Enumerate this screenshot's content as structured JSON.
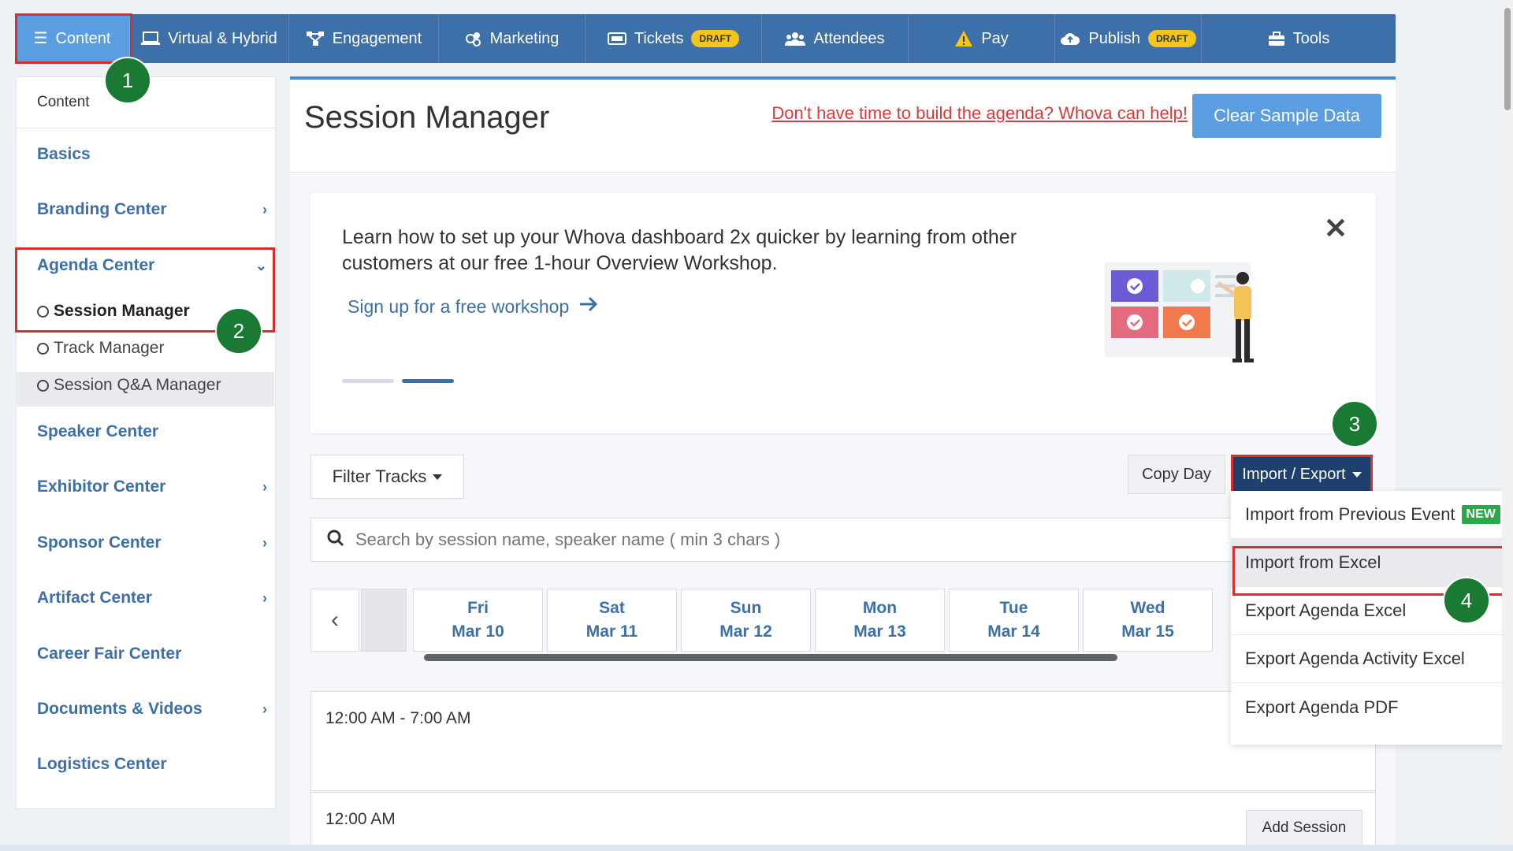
{
  "nav": {
    "tabs": [
      {
        "label": "Content",
        "icon": "list-icon"
      },
      {
        "label": "Virtual & Hybrid",
        "icon": "laptop-icon"
      },
      {
        "label": "Engagement",
        "icon": "network-icon"
      },
      {
        "label": "Marketing",
        "icon": "megaphone-icon"
      },
      {
        "label": "Tickets",
        "icon": "ticket-icon",
        "badge": "DRAFT"
      },
      {
        "label": "Attendees",
        "icon": "users-icon"
      },
      {
        "label": "Pay",
        "icon": "warning-icon"
      },
      {
        "label": "Publish",
        "icon": "cloud-upload-icon",
        "badge": "DRAFT"
      },
      {
        "label": "Tools",
        "icon": "toolbox-icon"
      }
    ],
    "active_tab": "Content",
    "colors": {
      "nav_bg": "#3d6fa8",
      "active": "#5a9de0",
      "draft_badge": "#f5c518"
    }
  },
  "steps": [
    "1",
    "2",
    "3",
    "4"
  ],
  "sidebar": {
    "header": "Content",
    "items": [
      {
        "label": "Basics",
        "chevron": ""
      },
      {
        "label": "Branding Center",
        "chevron": "›"
      },
      {
        "label": "Agenda Center",
        "chevron": "⌄"
      },
      {
        "label": "Speaker Center",
        "chevron": ""
      },
      {
        "label": "Exhibitor Center",
        "chevron": "›"
      },
      {
        "label": "Sponsor Center",
        "chevron": "›"
      },
      {
        "label": "Artifact Center",
        "chevron": "›"
      },
      {
        "label": "Career Fair Center",
        "chevron": ""
      },
      {
        "label": "Documents & Videos",
        "chevron": "›"
      },
      {
        "label": "Logistics Center",
        "chevron": ""
      }
    ],
    "agenda_subitems": [
      "Session Manager",
      "Track Manager",
      "Session Q&A Manager"
    ],
    "active_subitem": "Session Manager"
  },
  "main": {
    "title": "Session Manager",
    "help_link": "Don't have time to build the agenda? Whova can help!",
    "clear_button": "Clear Sample Data",
    "banner": {
      "text": "Learn how to set up your Whova dashboard 2x quicker by learning from other customers at our free 1-hour Overview Workshop.",
      "link": "Sign up for a free workshop",
      "close": "✕"
    },
    "filter_button": "Filter Tracks",
    "copy_day_button": "Copy Day",
    "import_export_button": "Import / Export",
    "search_placeholder": "Search by session name, speaker name ( min 3 chars )",
    "days": [
      {
        "dow": "Fri",
        "date": "Mar 10"
      },
      {
        "dow": "Sat",
        "date": "Mar 11"
      },
      {
        "dow": "Sun",
        "date": "Mar 12"
      },
      {
        "dow": "Mon",
        "date": "Mar 13"
      },
      {
        "dow": "Tue",
        "date": "Mar 14"
      },
      {
        "dow": "Wed",
        "date": "Mar 15"
      }
    ],
    "slots": [
      {
        "time": "12:00 AM - 7:00 AM"
      },
      {
        "time": "12:00 AM",
        "action": "Add Session"
      }
    ]
  },
  "dropdown": {
    "items": [
      {
        "label": "Import from Previous Event",
        "badge": "NEW"
      },
      {
        "label": "Import from Excel"
      },
      {
        "label": "Export Agenda Excel"
      },
      {
        "label": "Export Agenda Activity Excel"
      },
      {
        "label": "Export Agenda PDF"
      }
    ],
    "highlighted": "Import from Excel"
  }
}
